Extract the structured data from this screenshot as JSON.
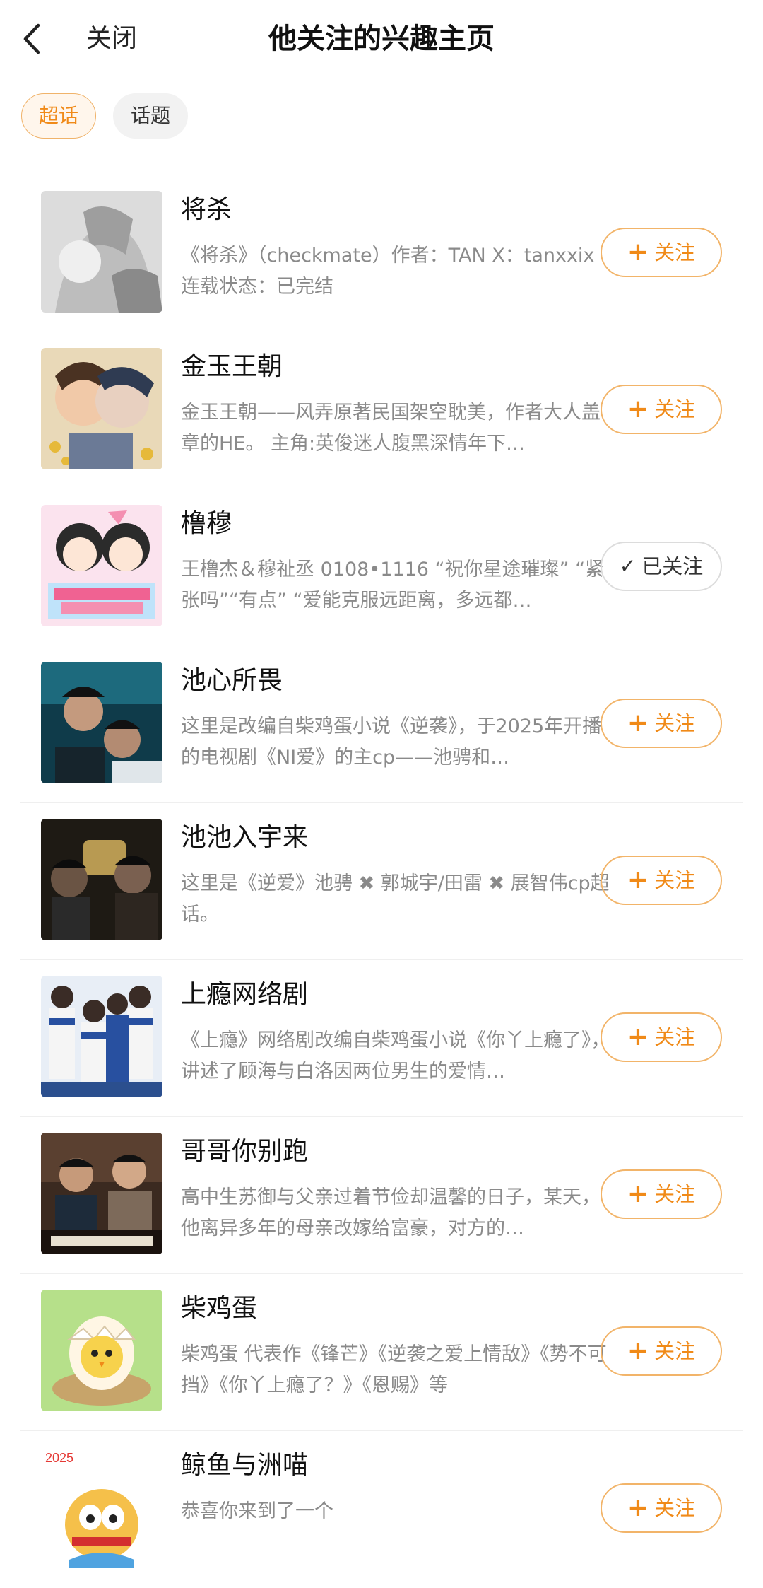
{
  "header": {
    "close_label": "关闭",
    "title": "他关注的兴趣主页"
  },
  "tabs": [
    {
      "label": "超话",
      "active": true
    },
    {
      "label": "话题",
      "active": false
    }
  ],
  "colors": {
    "accent": "#f08a18",
    "accent_border": "#f2b469",
    "desc_text": "#8a8a8a"
  },
  "items": [
    {
      "name": "将杀",
      "desc": "《将杀》（checkmate）作者：TAN X：tanxxix 连载状态：已完结",
      "button": "关注",
      "button_icon": "plus-icon",
      "followed": false
    },
    {
      "name": "金玉王朝",
      "desc": "金玉王朝——风弄原著民国架空耽美，作者大人盖章的HE。 主角:英俊迷人腹黑深情年下…",
      "button": "关注",
      "button_icon": "plus-icon",
      "followed": false
    },
    {
      "name": "橹穆",
      "desc": "王橹杰＆穆祉丞 0108•1116 “祝你星途璀璨” “紧张吗”“有点” “爱能克服远距离，多远都…",
      "button": "已关注",
      "button_icon": "check-icon",
      "followed": true
    },
    {
      "name": "池心所畏",
      "desc": "这里是改编自柴鸡蛋小说《逆袭》，于2025年开播的电视剧《NI爱》的主cp——池骋和…",
      "button": "关注",
      "button_icon": "plus-icon",
      "followed": false
    },
    {
      "name": "池池入宇来",
      "desc": "这里是《逆爱》池骋 ✖ 郭城宇/田雷 ✖ 展智伟cp超话。",
      "button": "关注",
      "button_icon": "plus-icon",
      "followed": false
    },
    {
      "name": "上瘾网络剧",
      "desc": "《上瘾》网络剧改编自柴鸡蛋小说《你丫上瘾了》，讲述了顾海与白洛因两位男生的爱情…",
      "button": "关注",
      "button_icon": "plus-icon",
      "followed": false
    },
    {
      "name": "哥哥你别跑",
      "desc": "高中生苏御与父亲过着节俭却温馨的日子，某天，他离异多年的母亲改嫁给富豪，对方的…",
      "button": "关注",
      "button_icon": "plus-icon",
      "followed": false
    },
    {
      "name": "柴鸡蛋",
      "desc": "柴鸡蛋 代表作《锋芒》《逆袭之爱上情敌》《势不可挡》《你丫上瘾了？》《恩赐》等",
      "button": "关注",
      "button_icon": "plus-icon",
      "followed": false
    },
    {
      "name": "鲸鱼与洲喵",
      "desc": "恭喜你来到了一个",
      "button": "关注",
      "button_icon": "plus-icon",
      "followed": false
    }
  ]
}
